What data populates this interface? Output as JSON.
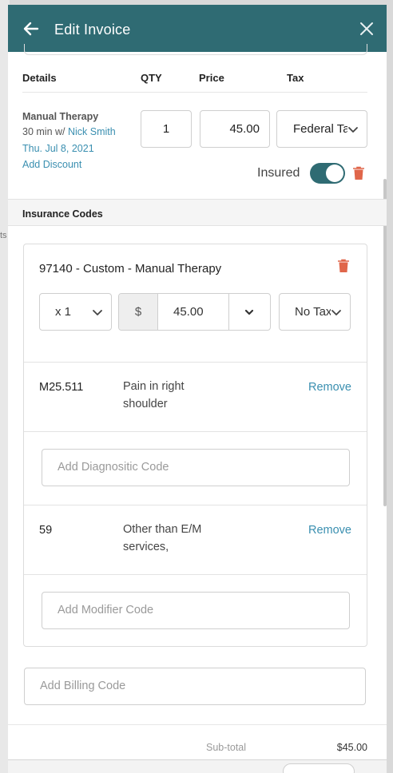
{
  "background": {
    "fragment_text": "ts"
  },
  "header": {
    "title": "Edit Invoice",
    "back_icon": "arrow-left-icon",
    "close_icon": "close-icon"
  },
  "table": {
    "headers": {
      "details": "Details",
      "qty": "QTY",
      "price": "Price",
      "tax": "Tax"
    }
  },
  "line_item": {
    "name": "Manual Therapy",
    "duration_prefix": "30 min w/ ",
    "provider": "Nick Smith",
    "date": "Thu. Jul 8, 2021",
    "add_discount": "Add Discount",
    "qty": "1",
    "price": "45.00",
    "tax": "Federal Tax",
    "insured_label": "Insured",
    "insured": true
  },
  "insurance": {
    "section_title": "Insurance Codes",
    "code_title": "97140 - Custom - Manual Therapy",
    "units": "x 1",
    "currency": "$",
    "price": "45.00",
    "tax": "No Tax",
    "diagnostic_codes": [
      {
        "code": "M25.511",
        "description": "Pain in right shoulder",
        "action": "Remove"
      }
    ],
    "diagnostic_placeholder": "Add Diagnositic Code",
    "modifier_codes": [
      {
        "code": "59",
        "description": "Other than E/M services,",
        "action": "Remove"
      }
    ],
    "modifier_placeholder": "Add Modifier Code"
  },
  "billing_placeholder": "Add Billing Code",
  "totals": {
    "subtotal_label": "Sub-total",
    "subtotal_value": "$45.00"
  },
  "colors": {
    "header": "#2f6b73",
    "link": "#3a8fb0",
    "delete": "#e0664a",
    "toggle_on": "#2f6b73"
  }
}
